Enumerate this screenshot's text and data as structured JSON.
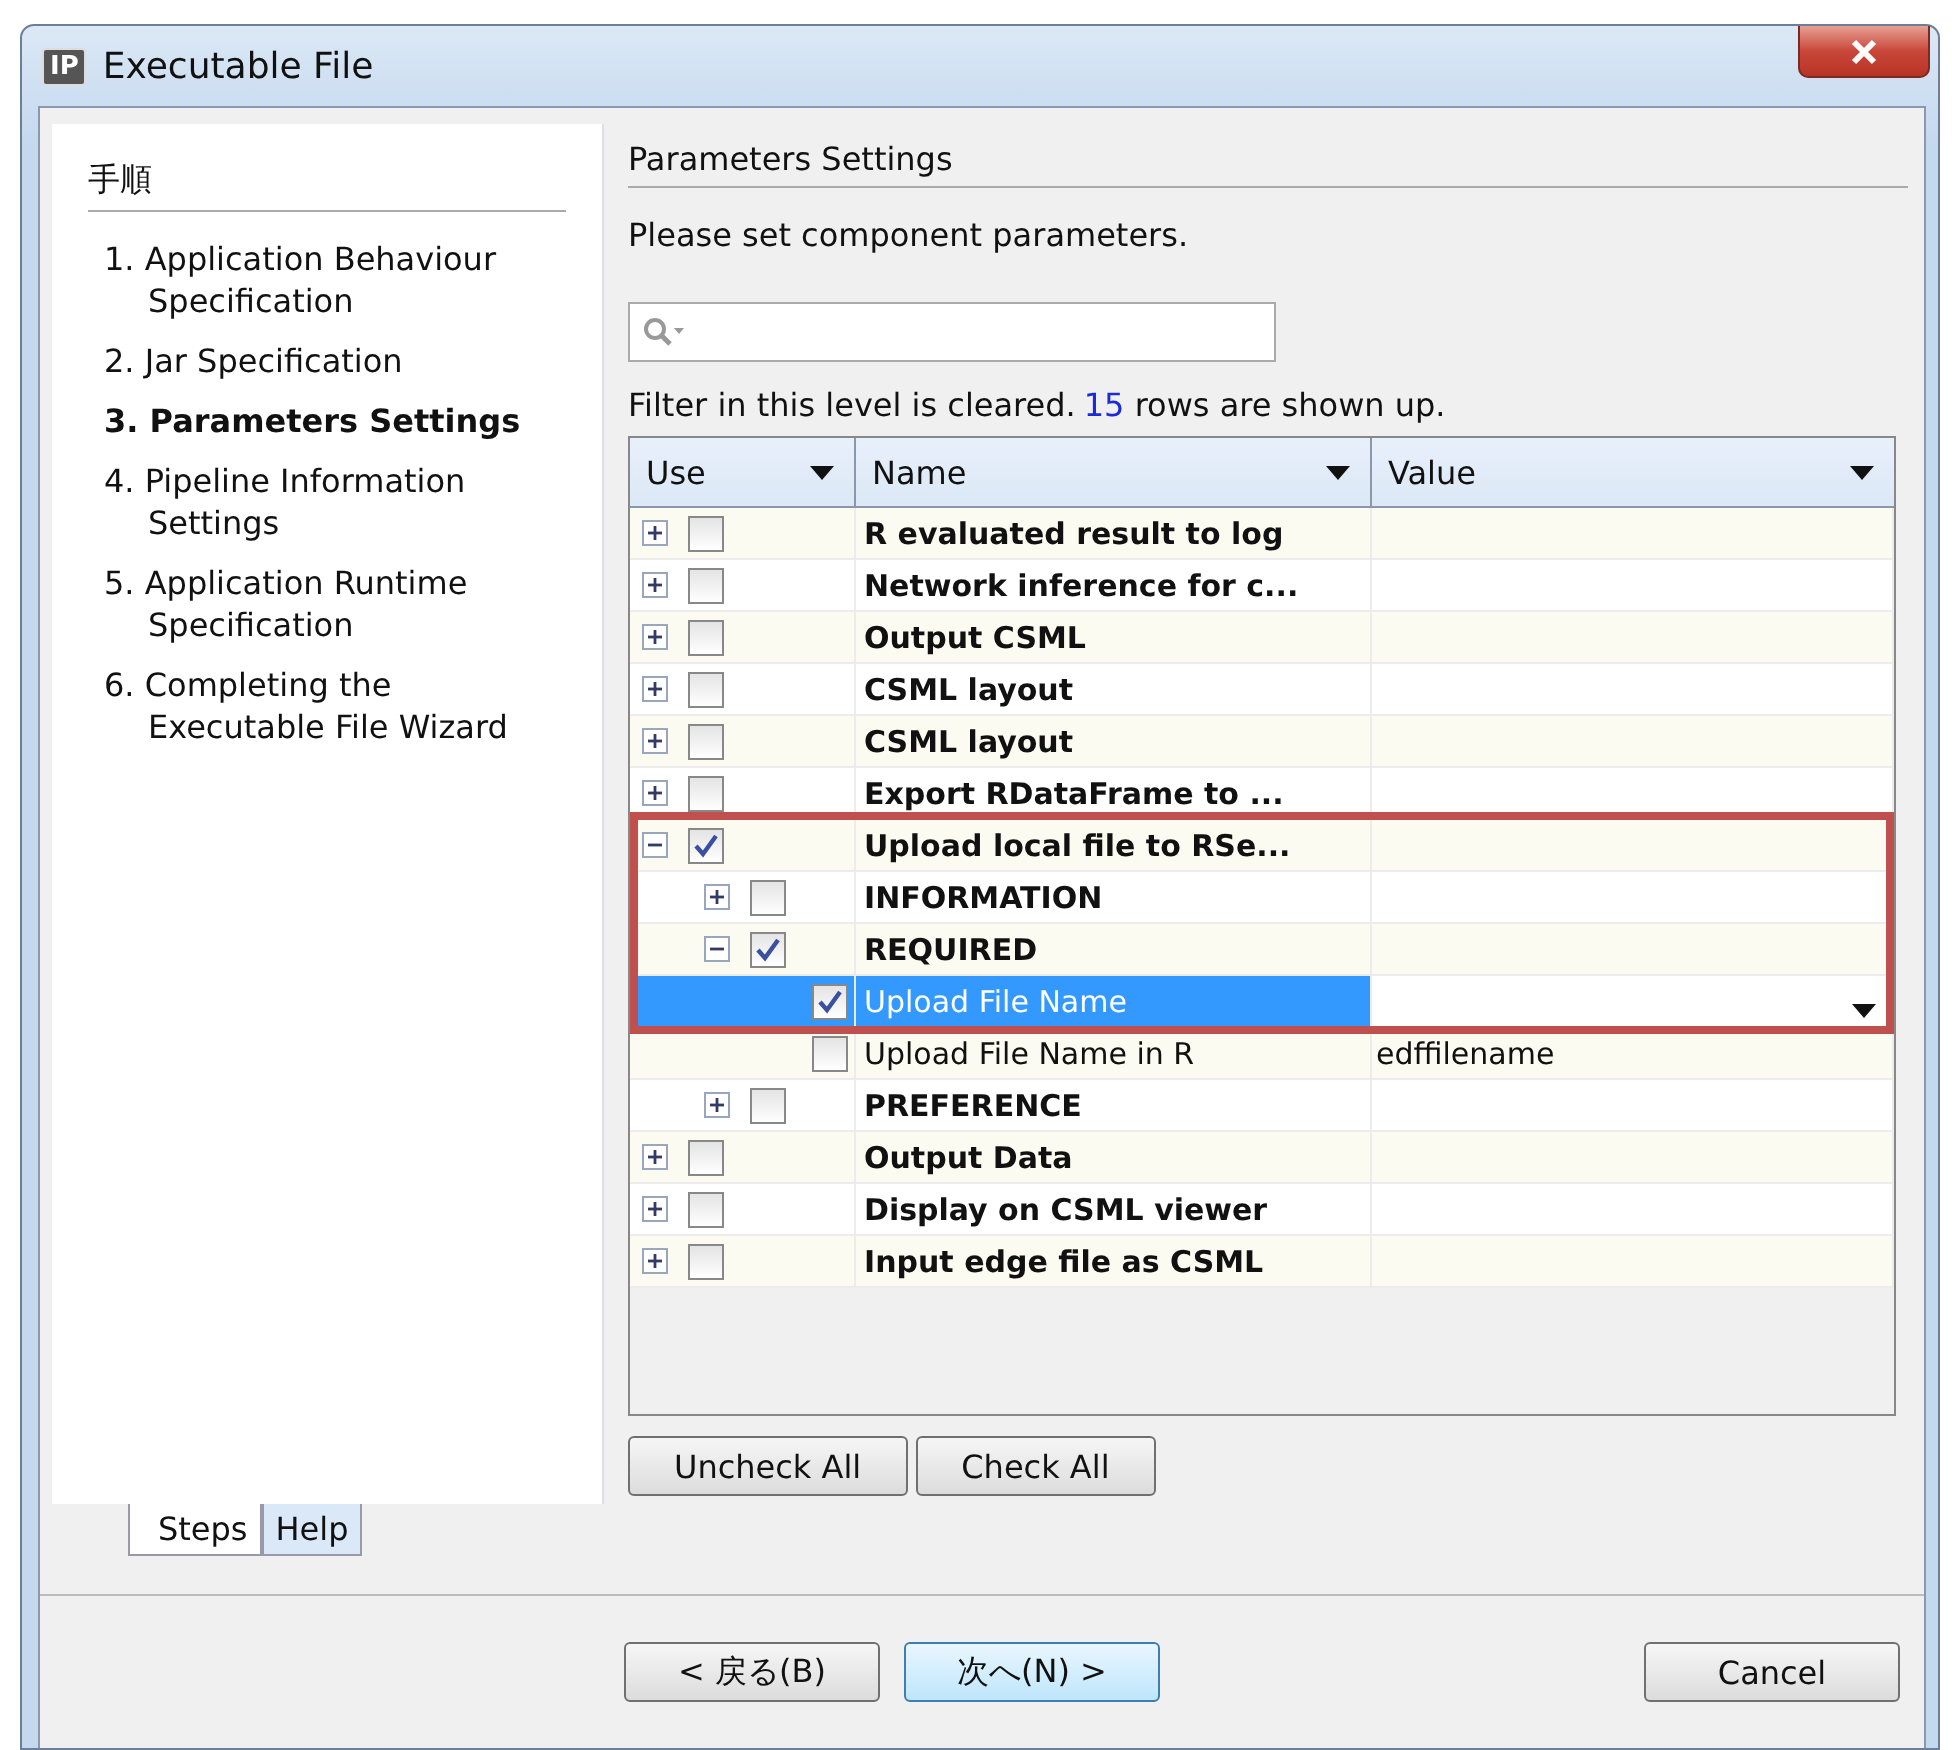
{
  "window": {
    "title": "Executable File",
    "app_badge": "IP"
  },
  "steps": {
    "heading": "手順",
    "items": [
      {
        "label": "1. Application Behaviour Specification",
        "selected": false
      },
      {
        "label": "2. Jar Specification",
        "selected": false
      },
      {
        "label": "3. Parameters Settings",
        "selected": true
      },
      {
        "label": "4. Pipeline Information Settings",
        "selected": false
      },
      {
        "label": "5. Application Runtime Specification",
        "selected": false
      },
      {
        "label": "6. Completing the Executable File Wizard",
        "selected": false
      }
    ]
  },
  "side_tabs": [
    {
      "label": "Steps",
      "selected": true
    },
    {
      "label": "Help",
      "selected": false
    }
  ],
  "section_title": "Parameters Settings",
  "instruction": "Please set component parameters.",
  "filter_status": {
    "before": "Filter in this level is cleared.",
    "count": "15",
    "after": "rows are shown up."
  },
  "table": {
    "columns": [
      "Use",
      "Name",
      "Value"
    ],
    "rows": [
      {
        "kind": "group",
        "name": "R evaluated result to log",
        "expanded": false,
        "checked": false,
        "selected": false,
        "highlighted": false
      },
      {
        "kind": "group",
        "name": "Network inference for c...",
        "expanded": false,
        "checked": false,
        "selected": false,
        "highlighted": false
      },
      {
        "kind": "group",
        "name": "Output CSML",
        "expanded": false,
        "checked": false,
        "selected": false,
        "highlighted": false
      },
      {
        "kind": "group",
        "name": "CSML layout",
        "expanded": false,
        "checked": false,
        "selected": false,
        "highlighted": false
      },
      {
        "kind": "group",
        "name": "CSML layout",
        "expanded": false,
        "checked": false,
        "selected": false,
        "highlighted": false
      },
      {
        "kind": "group",
        "name": "Export RDataFrame to ...",
        "expanded": false,
        "checked": false,
        "selected": false,
        "highlighted": false
      },
      {
        "kind": "group",
        "name": "Upload local file to RSe...",
        "expanded": true,
        "checked": true,
        "selected": false,
        "highlighted": true,
        "children": [
          {
            "kind": "group",
            "name": "INFORMATION",
            "expanded": false,
            "checked": false,
            "selected": false,
            "highlighted": true
          },
          {
            "kind": "group",
            "name": "REQUIRED",
            "expanded": true,
            "checked": true,
            "selected": false,
            "highlighted": true,
            "children": [
              {
                "kind": "parameter",
                "name": "Upload File Name",
                "checked": true,
                "selected": true,
                "highlighted": true
              },
              {
                "kind": "parameter",
                "name": "Upload File Name in R",
                "value": "edffilename",
                "checked": false,
                "selected": false,
                "highlighted": false
              }
            ]
          },
          {
            "kind": "group",
            "name": "PREFERENCE",
            "expanded": false,
            "checked": false,
            "selected": false,
            "highlighted": false
          }
        ]
      },
      {
        "kind": "group",
        "name": "Output Data",
        "expanded": false,
        "checked": false,
        "selected": false,
        "highlighted": false
      },
      {
        "kind": "group",
        "name": "Display on CSML viewer",
        "expanded": false,
        "checked": false,
        "selected": false,
        "highlighted": false
      },
      {
        "kind": "group",
        "name": "Input edge file as CSML",
        "expanded": false,
        "checked": false,
        "selected": false,
        "highlighted": false
      }
    ]
  },
  "table_buttons": [
    "Uncheck All",
    "Check All"
  ],
  "footer_buttons": [
    {
      "label": "< 戻る(B)",
      "selected": false
    },
    {
      "label": "次へ(N) >",
      "selected": true
    },
    {
      "label": "Cancel",
      "selected": false
    }
  ]
}
